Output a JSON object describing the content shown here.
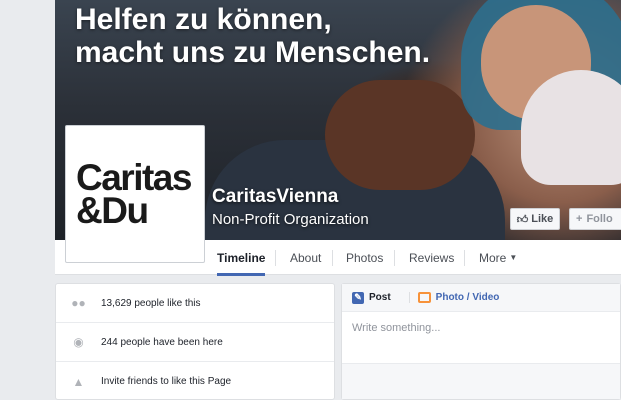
{
  "cover": {
    "headline_line1": "Helfen zu können,",
    "headline_line2": "macht uns zu Menschen."
  },
  "page": {
    "name": "CaritasVienna",
    "category": "Non-Profit Organization",
    "logo_line1": "Caritas",
    "logo_line2": "&Du"
  },
  "actions": {
    "like_label": "Like",
    "follow_label": "Follo"
  },
  "nav": {
    "tabs": [
      "Timeline",
      "About",
      "Photos",
      "Reviews",
      "More"
    ],
    "active": "Timeline"
  },
  "about": {
    "items": [
      {
        "icon": "likes-icon",
        "text": "13,629 people like this"
      },
      {
        "icon": "location-pin-icon",
        "text": "244 people have been here"
      },
      {
        "icon": "invite-friends-icon",
        "text": "Invite friends to like this Page"
      }
    ]
  },
  "composer": {
    "post_label": "Post",
    "photo_video_label": "Photo / Video",
    "placeholder": "Write something..."
  },
  "colors": {
    "brand_blue": "#4267b2",
    "background": "#e9ebee",
    "photo_orange": "#f7923a"
  }
}
